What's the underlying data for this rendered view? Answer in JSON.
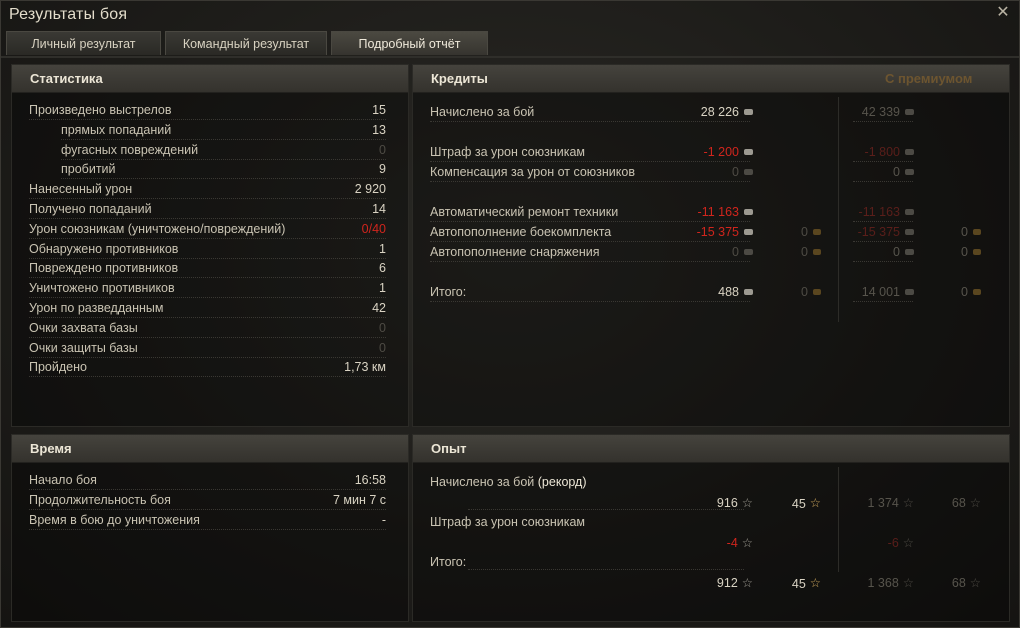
{
  "title": "Результаты боя",
  "tabs": [
    "Личный результат",
    "Командный результат",
    "Подробный отчёт"
  ],
  "stats": {
    "header": "Статистика",
    "rows": [
      {
        "label": "Произведено выстрелов",
        "value": "15"
      },
      {
        "label": "прямых попаданий",
        "value": "13"
      },
      {
        "label": "фугасных повреждений",
        "value": "0"
      },
      {
        "label": "пробитий",
        "value": "9"
      },
      {
        "label": "Нанесенный урон",
        "value": "2 920"
      },
      {
        "label": "Получено попаданий",
        "value": "14"
      },
      {
        "label": "Урон союзникам (уничтожено/повреждений)",
        "value": "0/40"
      },
      {
        "label": "Обнаружено противников",
        "value": "1"
      },
      {
        "label": "Повреждено противников",
        "value": "6"
      },
      {
        "label": "Уничтожено противников",
        "value": "1"
      },
      {
        "label": "Урон по разведданным",
        "value": "42"
      },
      {
        "label": "Очки захвата базы",
        "value": "0"
      },
      {
        "label": "Очки защиты базы",
        "value": "0"
      },
      {
        "label": "Пройдено",
        "value": "1,73 км"
      }
    ]
  },
  "time": {
    "header": "Время",
    "rows": [
      {
        "label": "Начало боя",
        "value": "16:58"
      },
      {
        "label": "Продолжительность боя",
        "value": "7 мин 7 с"
      },
      {
        "label": "Время в бою до уничтожения",
        "value": "-"
      }
    ]
  },
  "credits": {
    "header": "Кредиты",
    "premium": "С премиумом",
    "rows": [
      {
        "label": "Начислено за бой",
        "c": "28 226",
        "pc": "42 339"
      },
      {
        "label": "Штраф за урон союзникам",
        "c": "-1 200",
        "pc": "-1 800"
      },
      {
        "label": "Компенсация за урон от союзников",
        "c": "0",
        "pc": "0"
      },
      {
        "label": "Автоматический ремонт техники",
        "c": "-11 163",
        "pc": "-11 163"
      },
      {
        "label": "Автопополнение боекомплекта",
        "c": "-15 375",
        "g": "0",
        "pc": "-15 375",
        "pg": "0"
      },
      {
        "label": "Автопополнение снаряжения",
        "c": "0",
        "g": "0",
        "pc": "0",
        "pg": "0"
      },
      {
        "label": "Итого:",
        "c": "488",
        "g": "0",
        "pc": "14 001",
        "pg": "0"
      }
    ]
  },
  "exp": {
    "header": "Опыт",
    "earned_label": "Начислено за бой",
    "record": "(рекорд)",
    "earned": {
      "x": "916",
      "f": "45",
      "px": "1 374",
      "pf": "68"
    },
    "penalty_label": "Штраф за урон союзникам",
    "penalty": {
      "x": "-4",
      "px": "-6"
    },
    "total_label": "Итого:",
    "total": {
      "x": "912",
      "f": "45",
      "px": "1 368",
      "pf": "68"
    }
  },
  "icons": {
    "close": "close-icon",
    "credit": "credit-icon",
    "gold": "gold-icon",
    "exp": "exp-star-icon",
    "free_exp": "free-exp-star-icon"
  },
  "colors": {
    "negative": "#d0251d",
    "premium": "#6d5530"
  }
}
